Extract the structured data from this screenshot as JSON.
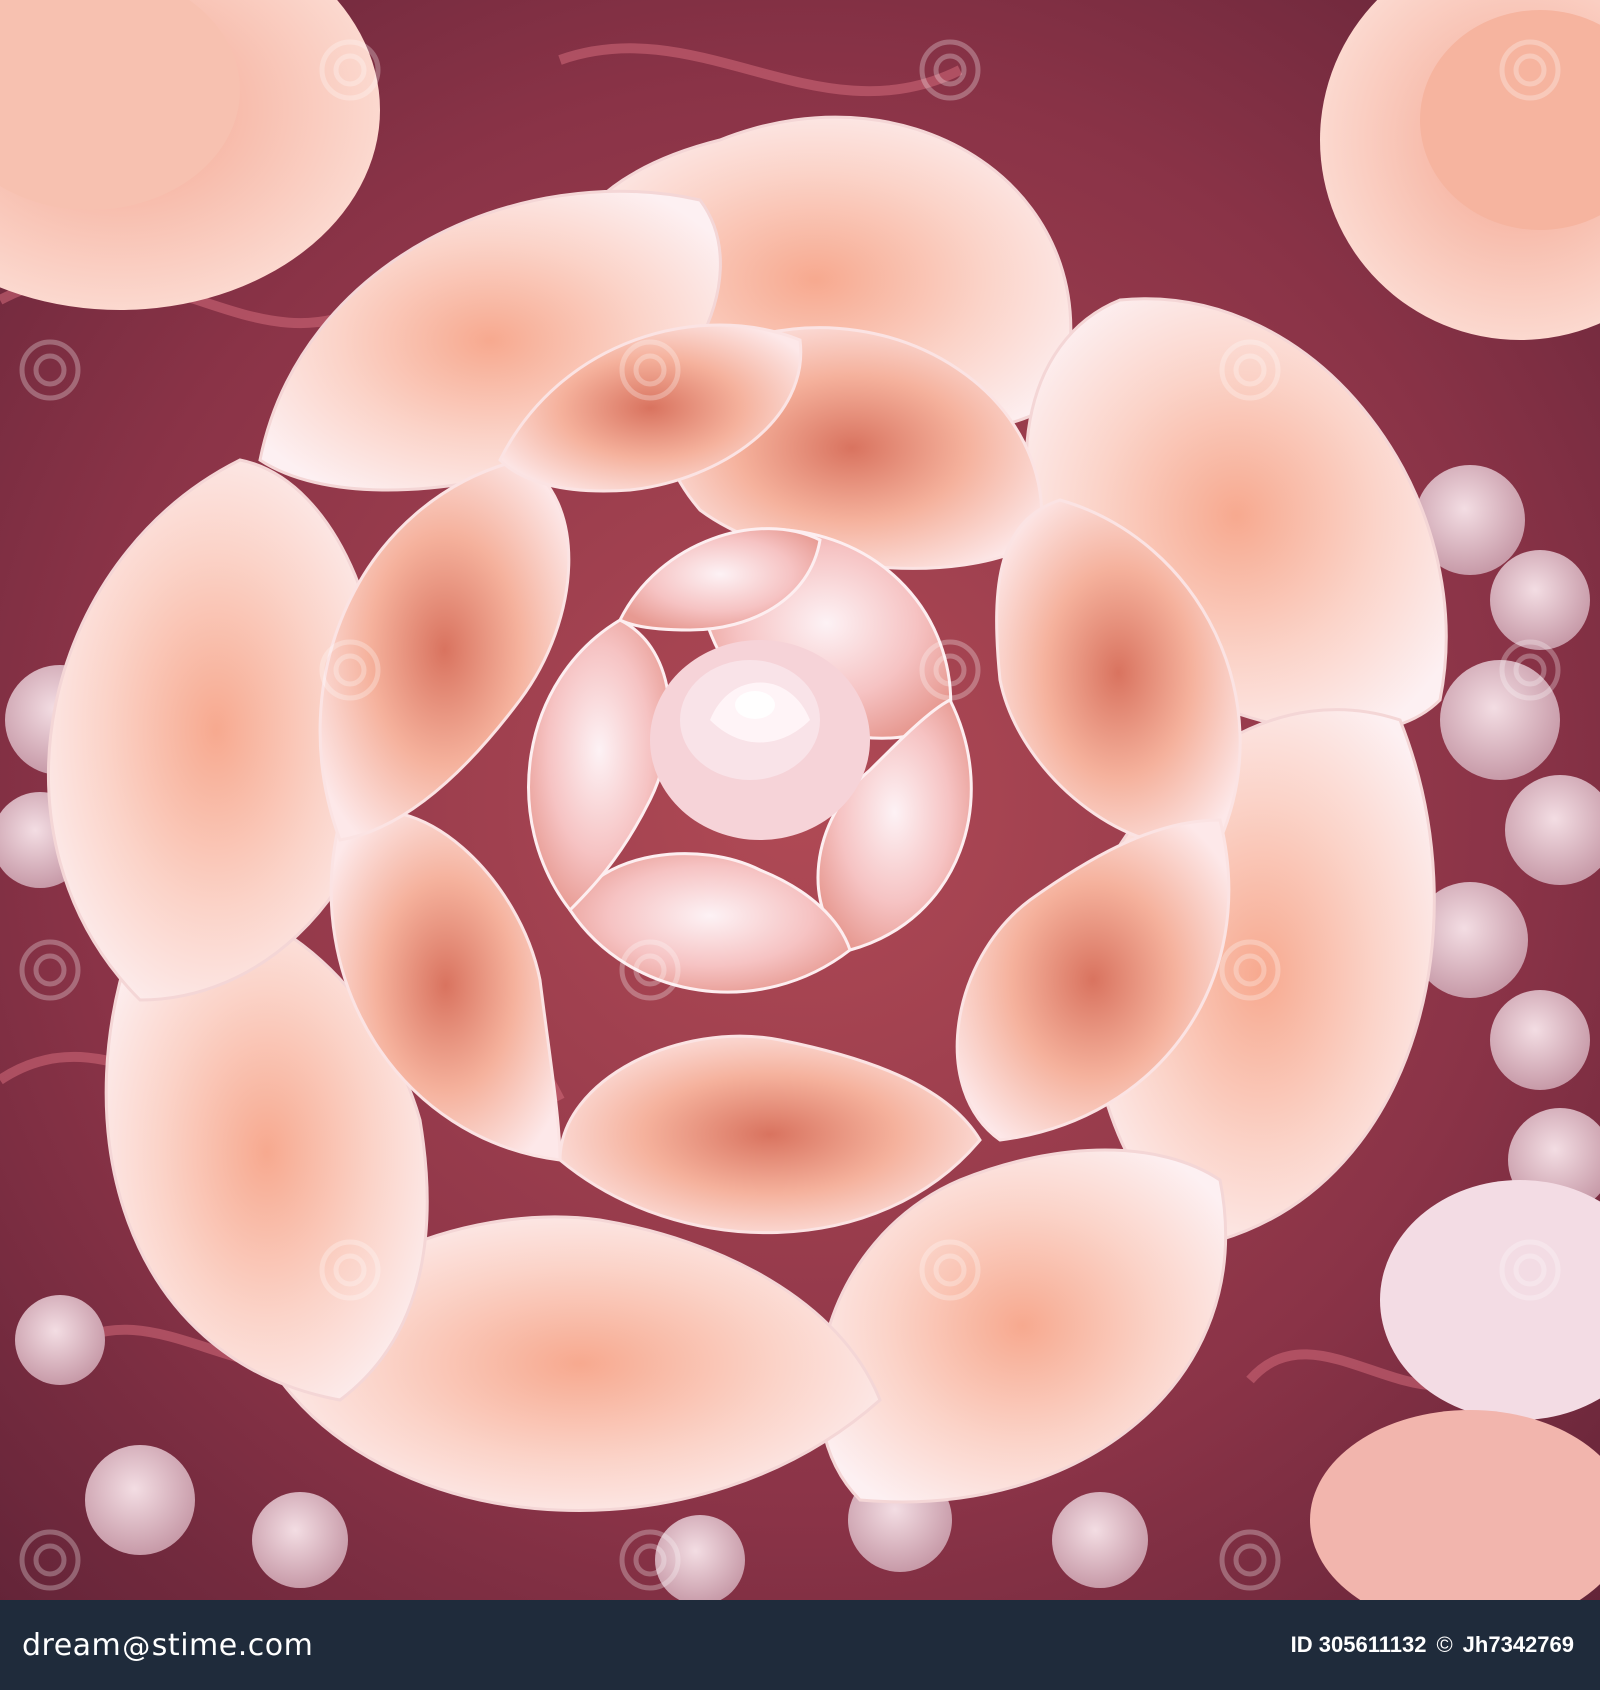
{
  "image": {
    "subject_icon": "rose-flower-icon",
    "colors": {
      "background_deep": "#7a2e3e",
      "petal_peach": "#f6b5a0",
      "petal_white": "#fbeef0",
      "petal_shadow": "#c9625a",
      "footer_bg": "#1f2b3b"
    }
  },
  "watermark": {
    "brand_text": "dreamstime",
    "icon": "spiral-icon"
  },
  "footer": {
    "brand_prefix": "dream",
    "brand_glyph": "@",
    "brand_suffix": "stime.com",
    "id_text": "ID 305611132",
    "copyright_glyph": "©",
    "author_text": "Jh7342769"
  }
}
